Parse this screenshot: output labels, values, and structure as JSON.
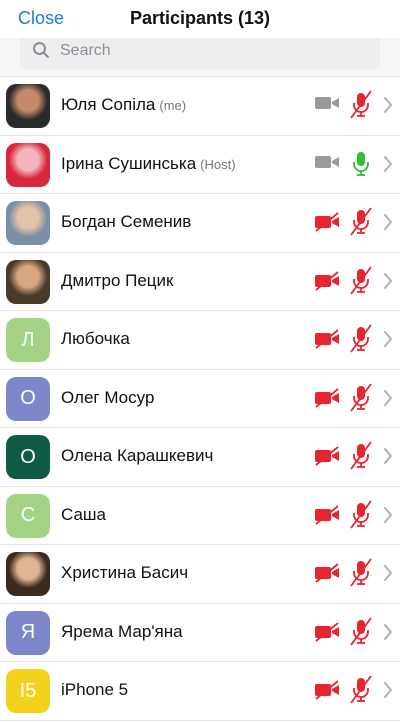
{
  "header": {
    "close_label": "Close",
    "title": "Participants (13)"
  },
  "search": {
    "placeholder": "Search"
  },
  "colors": {
    "accent": "#1f7ae0",
    "muted_red": "#e8242f",
    "mic_on_green": "#2fbf2f",
    "video_gray": "#9a9a9a"
  },
  "participants": [
    {
      "name": "Юля Сопіла",
      "tag": "(me)",
      "avatar": {
        "type": "photo",
        "palette": [
          "#2a2a2a",
          "#c48a6b"
        ]
      },
      "video": "on-gray",
      "mic": "muted"
    },
    {
      "name": "Ірина Сушинська",
      "tag": "(Host)",
      "avatar": {
        "type": "photo",
        "palette": [
          "#d8263a",
          "#f4b6be"
        ]
      },
      "video": "on-gray",
      "mic": "on"
    },
    {
      "name": "Богдан Семенив",
      "tag": "",
      "avatar": {
        "type": "photo",
        "palette": [
          "#7a8ea6",
          "#e5c3a6"
        ]
      },
      "video": "off",
      "mic": "muted"
    },
    {
      "name": "Дмитро Пецик",
      "tag": "",
      "avatar": {
        "type": "photo",
        "palette": [
          "#4a3a2a",
          "#d9a77f"
        ]
      },
      "video": "off",
      "mic": "muted"
    },
    {
      "name": "Любочка",
      "tag": "",
      "avatar": {
        "type": "letter",
        "letter": "Л",
        "color": "#a4d385"
      },
      "video": "off",
      "mic": "muted"
    },
    {
      "name": "Олег Мосур",
      "tag": "",
      "avatar": {
        "type": "letter",
        "letter": "О",
        "color": "#7d86c9"
      },
      "video": "off",
      "mic": "muted"
    },
    {
      "name": "Олена Карашкевич",
      "tag": "",
      "avatar": {
        "type": "letter",
        "letter": "О",
        "color": "#0f5b45"
      },
      "video": "off",
      "mic": "muted"
    },
    {
      "name": "Саша",
      "tag": "",
      "avatar": {
        "type": "letter",
        "letter": "С",
        "color": "#a4d385"
      },
      "video": "off",
      "mic": "muted"
    },
    {
      "name": "Христина Басич",
      "tag": "",
      "avatar": {
        "type": "photo",
        "palette": [
          "#3a2a20",
          "#e0b493"
        ]
      },
      "video": "off",
      "mic": "muted"
    },
    {
      "name": "Ярема Мар'яна",
      "tag": "",
      "avatar": {
        "type": "letter",
        "letter": "Я",
        "color": "#7d86c9"
      },
      "video": "off",
      "mic": "muted"
    },
    {
      "name": "iPhone 5",
      "tag": "",
      "avatar": {
        "type": "letter",
        "letter": "I5",
        "color": "#f3d21b"
      },
      "video": "off",
      "mic": "muted"
    }
  ]
}
